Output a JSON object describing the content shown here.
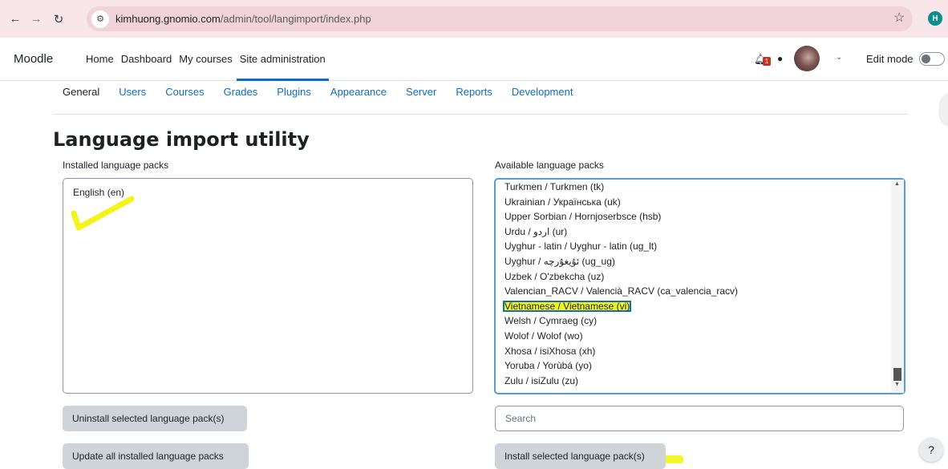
{
  "browser": {
    "url_host": "kimhuong.gnomio.com",
    "url_path": "/admin/tool/langimport/index.php",
    "profile_initial": "H"
  },
  "navbar": {
    "brand": "Moodle",
    "items": [
      "Home",
      "Dashboard",
      "My courses",
      "Site administration"
    ],
    "notification_count": "1",
    "edit_mode_label": "Edit mode"
  },
  "secondary_nav": [
    "General",
    "Users",
    "Courses",
    "Grades",
    "Plugins",
    "Appearance",
    "Server",
    "Reports",
    "Development"
  ],
  "page": {
    "title": "Language import utility",
    "installed_label": "Installed language packs",
    "available_label": "Available language packs",
    "installed_packs": [
      "English (en)"
    ],
    "available_packs": [
      "Turkmen / Turkmen (tk)",
      "Ukrainian / Українська (uk)",
      "Upper Sorbian / Hornjoserbsce (hsb)",
      "Urdu / اردو (ur)",
      "Uyghur - latin / Uyghur - latin (ug_lt)",
      "Uyghur / ئۇيغۇرچە (ug_ug)",
      "Uzbek / O'zbekcha (uz)",
      "Valencian_RACV / Valencià_RACV (ca_valencia_racv)",
      "Vietnamese / Vietnamese (vi)",
      "Welsh / Cymraeg (cy)",
      "Wolof / Wolof (wo)",
      "Xhosa / isiXhosa (xh)",
      "Yoruba / Yorùbá (yo)",
      "Zulu / isiZulu (zu)"
    ],
    "selected_pack": "Vietnamese / Vietnamese (vi)",
    "uninstall_button": "Uninstall selected language pack(s)",
    "update_button": "Update all installed language packs",
    "install_button": "Install selected language pack(s)",
    "search_placeholder": "Search",
    "help_label": "?"
  },
  "colors": {
    "accent": "#0f6cbf",
    "highlight": "#f3f51a",
    "browser_bar": "#f9e6ea"
  }
}
